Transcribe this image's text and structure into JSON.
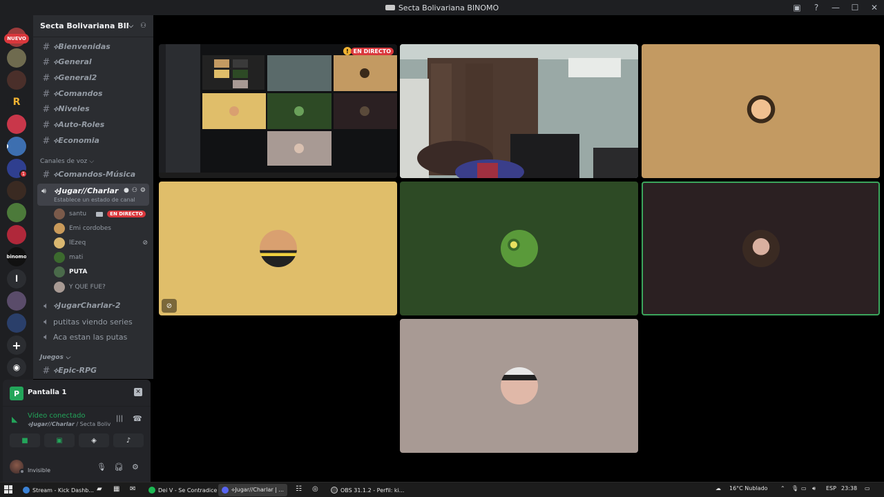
{
  "window": {
    "title": "Secta Bolivariana BINOMO"
  },
  "rail": {
    "new_badge": "NUEVO",
    "badge_count": "1",
    "letter_r": "R",
    "letter_binomo": "binomo",
    "letter_l": "l",
    "add_label": "+"
  },
  "server": {
    "name": "Secta Bolivariana BINO..."
  },
  "channels": {
    "text": [
      "⟡Bienvenidas",
      "⟡General",
      "⟡General2",
      "⟡Comandos",
      "⟡Niveles",
      "⟡Auto-Roles",
      "⟡Economia"
    ],
    "voice_category": "Canales de voz",
    "voice_music": "⟡Comandos-Música",
    "active_voice": {
      "name": "⟡Jugar//Charlar",
      "status": "Establece un estado de canal"
    },
    "voice_users": [
      {
        "name": "santu",
        "live": "EN DIRECTO"
      },
      {
        "name": "Emi cordobes"
      },
      {
        "name": "lEzeq"
      },
      {
        "name": "mati"
      },
      {
        "name": "PUTA"
      },
      {
        "name": "Y QUE FUE?"
      }
    ],
    "more_voice": [
      "⟡JugarCharlar-2",
      "putitas viendo series",
      "Aca estan las putas"
    ],
    "games_category": "Juegos",
    "games": [
      "⟡Epic-RPG"
    ]
  },
  "voice_panel": {
    "title": "Pantalla 1",
    "tile_letter": "P",
    "connected": "Vídeo conectado",
    "channel": "⟡Jugar//Charlar",
    "server": " / Secta Boliv..."
  },
  "user_panel": {
    "status": "Invisible"
  },
  "stage": {
    "live_label": "EN DIRECTO",
    "warning": "!"
  },
  "taskbar": {
    "items": [
      "Stream - Kick Dashb...",
      "Dei V - Se Contradice",
      "⟡Jugar//Charlar | ...",
      "OBS 31.1.2 - Perfil: ki..."
    ],
    "weather": "16°C  Nublado",
    "lang": "ESP",
    "time": "23:38"
  },
  "colors": {
    "accent_green": "#23a55a",
    "live_red": "#da373c",
    "tile_tan": "#c39a62",
    "tile_gold": "#e0be6a",
    "tile_green": "#2d4a25",
    "tile_dark": "#2b2022",
    "tile_gray": "#a89a94"
  }
}
